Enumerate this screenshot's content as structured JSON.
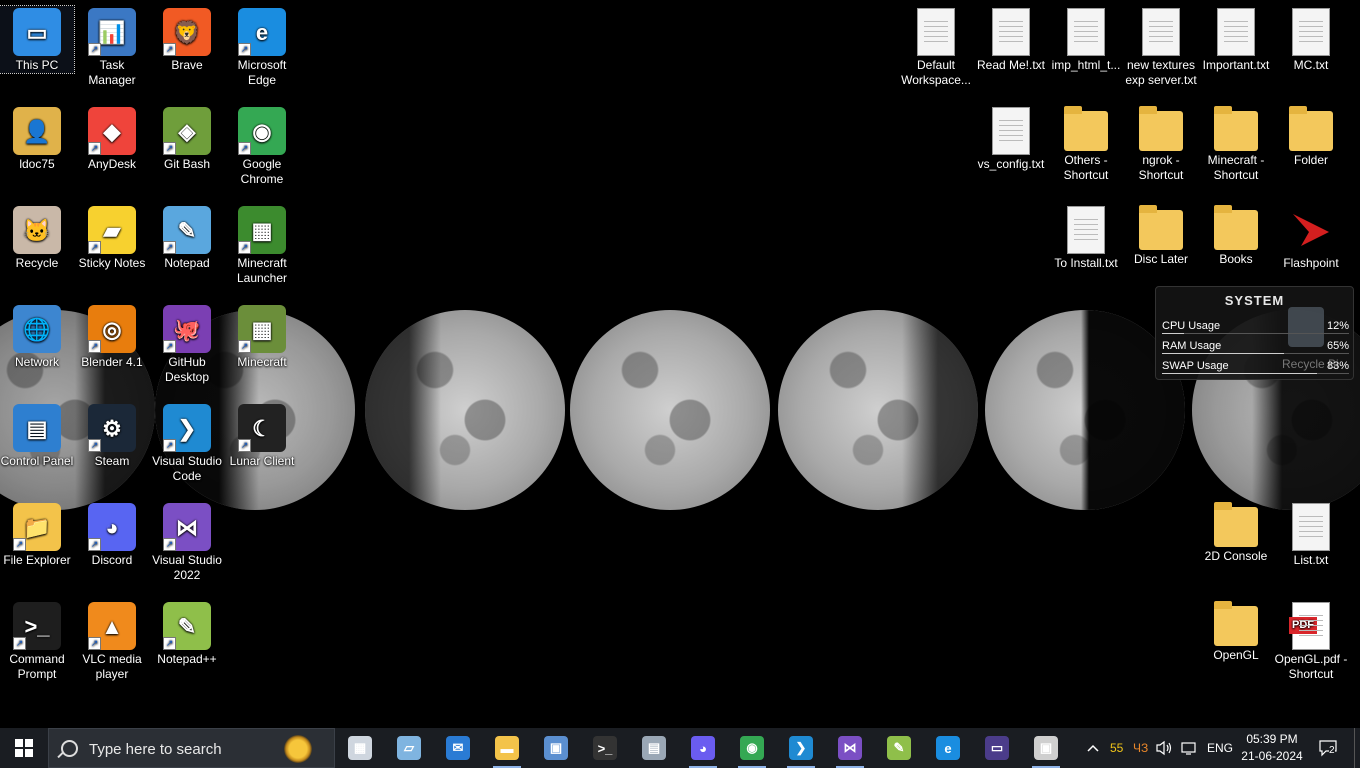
{
  "desktop": {
    "left_icons": [
      {
        "label": "This PC",
        "name": "this-pc",
        "col": 0,
        "row": 0,
        "color": "#2f8de4",
        "glyph": "▭",
        "selected": true,
        "shortcut": false
      },
      {
        "label": "Task Manager",
        "name": "task-manager",
        "col": 1,
        "row": 0,
        "color": "#3b78c4",
        "glyph": "📊",
        "selected": false,
        "shortcut": true
      },
      {
        "label": "Brave",
        "name": "brave",
        "col": 2,
        "row": 0,
        "color": "#f15a24",
        "glyph": "🦁",
        "selected": false,
        "shortcut": true
      },
      {
        "label": "Microsoft Edge",
        "name": "microsoft-edge",
        "col": 3,
        "row": 0,
        "color": "#1a8de0",
        "glyph": "e",
        "selected": false,
        "shortcut": true
      },
      {
        "label": "ldoc75",
        "name": "ldoc75",
        "col": 0,
        "row": 1,
        "color": "#e0b24a",
        "glyph": "👤",
        "selected": false,
        "shortcut": false
      },
      {
        "label": "AnyDesk",
        "name": "anydesk",
        "col": 1,
        "row": 1,
        "color": "#ef443b",
        "glyph": "◆",
        "selected": false,
        "shortcut": true
      },
      {
        "label": "Git Bash",
        "name": "git-bash",
        "col": 2,
        "row": 1,
        "color": "#6f9e3b",
        "glyph": "◈",
        "selected": false,
        "shortcut": true
      },
      {
        "label": "Google Chrome",
        "name": "google-chrome",
        "col": 3,
        "row": 1,
        "color": "#34a853",
        "glyph": "◉",
        "selected": false,
        "shortcut": true
      },
      {
        "label": "Recycle",
        "name": "recycle",
        "col": 0,
        "row": 2,
        "color": "#c9b8a8",
        "glyph": "🐱",
        "selected": false,
        "shortcut": false
      },
      {
        "label": "Sticky Notes",
        "name": "sticky-notes",
        "col": 1,
        "row": 2,
        "color": "#f7d12f",
        "glyph": "▰",
        "selected": false,
        "shortcut": true
      },
      {
        "label": "Notepad",
        "name": "notepad",
        "col": 2,
        "row": 2,
        "color": "#5aa7de",
        "glyph": "✎",
        "selected": false,
        "shortcut": true
      },
      {
        "label": "Minecraft Launcher",
        "name": "minecraft-launcher",
        "col": 3,
        "row": 2,
        "color": "#3c8b2e",
        "glyph": "▦",
        "selected": false,
        "shortcut": true
      },
      {
        "label": "Network",
        "name": "network",
        "col": 0,
        "row": 3,
        "color": "#3d86d0",
        "glyph": "🌐",
        "selected": false,
        "shortcut": false
      },
      {
        "label": "Blender 4.1",
        "name": "blender",
        "col": 1,
        "row": 3,
        "color": "#e87d0d",
        "glyph": "◎",
        "selected": false,
        "shortcut": true
      },
      {
        "label": "GitHub Desktop",
        "name": "github-desktop",
        "col": 2,
        "row": 3,
        "color": "#7b3fb3",
        "glyph": "🐙",
        "selected": false,
        "shortcut": true
      },
      {
        "label": "Minecraft",
        "name": "minecraft",
        "col": 3,
        "row": 3,
        "color": "#6b8e3a",
        "glyph": "▦",
        "selected": false,
        "shortcut": true
      },
      {
        "label": "Control Panel",
        "name": "control-panel",
        "col": 0,
        "row": 4,
        "color": "#2e7fd0",
        "glyph": "▤",
        "selected": false,
        "shortcut": false
      },
      {
        "label": "Steam",
        "name": "steam",
        "col": 1,
        "row": 4,
        "color": "#1b2838",
        "glyph": "⚙",
        "selected": false,
        "shortcut": true
      },
      {
        "label": "Visual Studio Code",
        "name": "vs-code",
        "col": 2,
        "row": 4,
        "color": "#1f8ad2",
        "glyph": "❯",
        "selected": false,
        "shortcut": true
      },
      {
        "label": "Lunar Client",
        "name": "lunar-client",
        "col": 3,
        "row": 4,
        "color": "#222222",
        "glyph": "☾",
        "selected": false,
        "shortcut": true
      },
      {
        "label": "File Explorer",
        "name": "file-explorer",
        "col": 0,
        "row": 5,
        "color": "#f3c34a",
        "glyph": "📁",
        "selected": false,
        "shortcut": true
      },
      {
        "label": "Discord",
        "name": "discord",
        "col": 1,
        "row": 5,
        "color": "#5865f2",
        "glyph": "◕",
        "selected": false,
        "shortcut": true
      },
      {
        "label": "Visual Studio 2022",
        "name": "visual-studio-2022",
        "col": 2,
        "row": 5,
        "color": "#7b4fc4",
        "glyph": "⋈",
        "selected": false,
        "shortcut": true
      },
      {
        "label": "Command Prompt",
        "name": "command-prompt",
        "col": 0,
        "row": 6,
        "color": "#1e1e1e",
        "glyph": ">_",
        "selected": false,
        "shortcut": true
      },
      {
        "label": "VLC media player",
        "name": "vlc",
        "col": 1,
        "row": 6,
        "color": "#f08a1c",
        "glyph": "▲",
        "selected": false,
        "shortcut": true
      },
      {
        "label": "Notepad++",
        "name": "notepad-plus-plus",
        "col": 2,
        "row": 6,
        "color": "#8fbf4a",
        "glyph": "✎",
        "selected": false,
        "shortcut": true
      }
    ],
    "right_icons": [
      {
        "label": "Default Workspace...",
        "name": "default-workspace",
        "col": 0,
        "row": 0,
        "kind": "doc"
      },
      {
        "label": "Read Me!.txt",
        "name": "read-me-txt",
        "col": 1,
        "row": 0,
        "kind": "doc"
      },
      {
        "label": "imp_html_t...",
        "name": "imp-html-txt",
        "col": 2,
        "row": 0,
        "kind": "doc"
      },
      {
        "label": "new textures exp server.txt",
        "name": "new-textures-txt",
        "col": 3,
        "row": 0,
        "kind": "doc"
      },
      {
        "label": "Important.txt",
        "name": "important-txt",
        "col": 4,
        "row": 0,
        "kind": "doc"
      },
      {
        "label": "MC.txt",
        "name": "mc-txt",
        "col": 5,
        "row": 0,
        "kind": "doc"
      },
      {
        "label": "vs_config.txt",
        "name": "vs-config-txt",
        "col": 1,
        "row": 1,
        "kind": "doc"
      },
      {
        "label": "Others - Shortcut",
        "name": "others-shortcut",
        "col": 2,
        "row": 1,
        "kind": "folder"
      },
      {
        "label": "ngrok - Shortcut",
        "name": "ngrok-shortcut",
        "col": 3,
        "row": 1,
        "kind": "folder"
      },
      {
        "label": "Minecraft - Shortcut",
        "name": "minecraft-shortcut",
        "col": 4,
        "row": 1,
        "kind": "folder"
      },
      {
        "label": "Folder",
        "name": "folder",
        "col": 5,
        "row": 1,
        "kind": "folder"
      },
      {
        "label": "To Install.txt",
        "name": "to-install-txt",
        "col": 2,
        "row": 2,
        "kind": "doc"
      },
      {
        "label": "Disc Later",
        "name": "disc-later",
        "col": 3,
        "row": 2,
        "kind": "folder"
      },
      {
        "label": "Books",
        "name": "books",
        "col": 4,
        "row": 2,
        "kind": "folder"
      },
      {
        "label": "Flashpoint",
        "name": "flashpoint",
        "col": 5,
        "row": 2,
        "kind": "app"
      },
      {
        "label": "2D Console",
        "name": "2d-console",
        "col": 4,
        "row": 5,
        "kind": "folder"
      },
      {
        "label": "List.txt",
        "name": "list-txt",
        "col": 5,
        "row": 5,
        "kind": "doc"
      },
      {
        "label": "OpenGL",
        "name": "opengl",
        "col": 4,
        "row": 6,
        "kind": "folder"
      },
      {
        "label": "OpenGL.pdf - Shortcut",
        "name": "opengl-pdf-shortcut",
        "col": 5,
        "row": 6,
        "kind": "pdf"
      }
    ]
  },
  "widget": {
    "title": "SYSTEM",
    "rows": [
      {
        "label": "CPU Usage",
        "value": "12%",
        "fraction": 0.12
      },
      {
        "label": "RAM Usage",
        "value": "65%",
        "fraction": 0.65
      },
      {
        "label": "SWAP Usage",
        "value": "83%",
        "fraction": 0.83
      }
    ],
    "ghost_label": "Recycle Bi"
  },
  "taskbar": {
    "search_placeholder": "Type here to search",
    "apps": [
      {
        "name": "task-view",
        "color": "#cfd6df",
        "glyph": "▦"
      },
      {
        "name": "notes-app",
        "color": "#7fb4e0",
        "glyph": "▱"
      },
      {
        "name": "mail",
        "color": "#2a7bd4",
        "glyph": "✉"
      },
      {
        "name": "file-explorer",
        "color": "#f3c34a",
        "glyph": "▬",
        "active": true
      },
      {
        "name": "remote-desktop",
        "color": "#5b8fd0",
        "glyph": "▣"
      },
      {
        "name": "terminal",
        "color": "#333333",
        "glyph": ">_"
      },
      {
        "name": "system-tools",
        "color": "#9aa7b5",
        "glyph": "▤"
      },
      {
        "name": "discord-badge",
        "color": "#6a5cf0",
        "glyph": "◕",
        "active": true
      },
      {
        "name": "chrome",
        "color": "#34a853",
        "glyph": "◉",
        "active": true
      },
      {
        "name": "vs-code",
        "color": "#1f8ad2",
        "glyph": "❯",
        "active": true
      },
      {
        "name": "visual-studio",
        "color": "#7b4fc4",
        "glyph": "⋈",
        "active": true
      },
      {
        "name": "notepad-plus",
        "color": "#8fbf4a",
        "glyph": "✎"
      },
      {
        "name": "edge",
        "color": "#1a8de0",
        "glyph": "e"
      },
      {
        "name": "monitor-app",
        "color": "#4b3c8a",
        "glyph": "▭"
      },
      {
        "name": "settings-app",
        "color": "#cfcfcf",
        "glyph": "▣",
        "active": true
      }
    ],
    "tray": {
      "temp": "55",
      "temp_color": "#f0c419",
      "cpu_tag": "ЧЗ",
      "cpu_tag_color": "#e8862a",
      "lang": "ENG",
      "time": "05:39 PM",
      "date": "21-06-2024",
      "notifications": "2"
    }
  }
}
